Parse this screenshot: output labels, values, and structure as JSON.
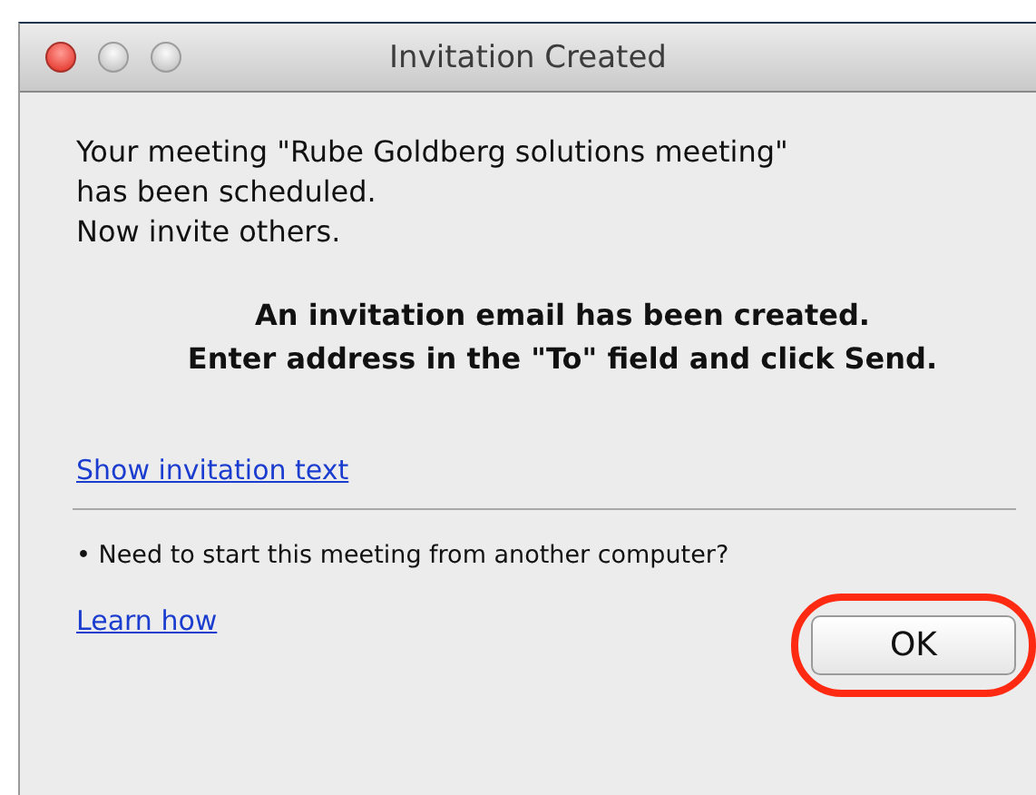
{
  "window": {
    "title": "Invitation Created"
  },
  "message": [
    "Your meeting \"Rube Goldberg solutions meeting\"",
    "has been scheduled.",
    "Now invite others."
  ],
  "instructions": [
    "An invitation email has been created.",
    "Enter address in the \"To\" field and click Send."
  ],
  "show_link": "Show invitation text",
  "note": "• Need to start this meeting from another computer?",
  "learn_link": "Learn how",
  "ok_button": {
    "label": "OK",
    "highlighted": true
  }
}
